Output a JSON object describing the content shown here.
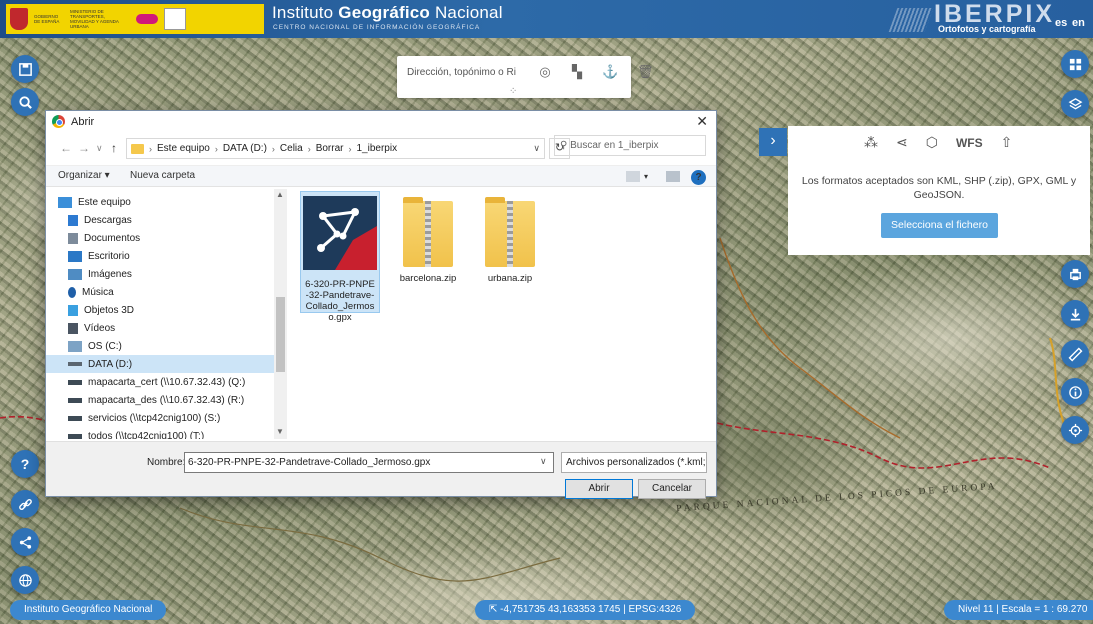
{
  "header": {
    "gov_text_1": "GOBIERNO DE ESPAÑA",
    "gov_text_2": "MINISTERIO DE TRANSPORTES, MOVILIDAD Y AGENDA URBANA",
    "ign_title_light": "Instituto ",
    "ign_title_bold": "Geográfico",
    "ign_title_rest": " Nacional",
    "ign_subtitle": "CENTRO NACIONAL DE INFORMACIÓN GEOGRÁFICA",
    "app_title": "IBERPIX",
    "app_subtitle": "Ortofotos y cartografía",
    "lang_es": "es",
    "lang_en": "en"
  },
  "search": {
    "placeholder": "Dirección, topónimo o Ri"
  },
  "map": {
    "park_label": "PARQUE NACIONAL DE LOS PICOS DE EUROPA"
  },
  "import_panel": {
    "wfs_label": "WFS",
    "message": "Los formatos aceptados son KML, SHP (.zip), GPX, GML y GeoJSON.",
    "select_button": "Selecciona el fichero"
  },
  "dialog": {
    "title": "Abrir",
    "close": "✕",
    "breadcrumb": [
      "Este equipo",
      "DATA (D:)",
      "Celia",
      "Borrar",
      "1_iberpix"
    ],
    "search_placeholder": "Buscar en 1_iberpix",
    "organize": "Organizar ▾",
    "new_folder": "Nueva carpeta",
    "tree": [
      {
        "label": "Este equipo",
        "color": "#3b8fd9"
      },
      {
        "label": "Descargas",
        "color": "#2d7ad1"
      },
      {
        "label": "Documentos",
        "color": "#7d8b9b"
      },
      {
        "label": "Escritorio",
        "color": "#2b78c6"
      },
      {
        "label": "Imágenes",
        "color": "#4f8cc3"
      },
      {
        "label": "Música",
        "color": "#1f5fa8"
      },
      {
        "label": "Objetos 3D",
        "color": "#3aa0e0"
      },
      {
        "label": "Vídeos",
        "color": "#4a5562"
      },
      {
        "label": "OS (C:)",
        "color": "#7da3c5"
      },
      {
        "label": "DATA (D:)",
        "color": "#5b6670"
      },
      {
        "label": "mapacarta_cert (\\\\10.67.32.43) (Q:)",
        "color": "#3d4a55"
      },
      {
        "label": "mapacarta_des (\\\\10.67.32.43) (R:)",
        "color": "#3d4a55"
      },
      {
        "label": "servicios (\\\\tcp42cnig100) (S:)",
        "color": "#3d4a55"
      },
      {
        "label": "todos (\\\\tcp42cnig100) (T:)",
        "color": "#3d4a55"
      }
    ],
    "files": [
      {
        "name": "6-320-PR-PNPE-32-Pandetrave-Collado_Jermoso.gpx",
        "display": "6-320-PR-PNPE-32-Pandetrave-Collado_Jermoso.gpx"
      },
      {
        "name": "barcelona.zip",
        "display": "barcelona.zip"
      },
      {
        "name": "urbana.zip",
        "display": "urbana.zip"
      }
    ],
    "filename_label": "Nombre:",
    "filename_value": "6-320-PR-PNPE-32-Pandetrave-Collado_Jermoso.gpx",
    "filetype": "Archivos personalizados (*.kml; ∨",
    "open_button": "Abrir",
    "cancel_button": "Cancelar"
  },
  "footer": {
    "ign_label": "Instituto Geográfico Nacional",
    "coords": "-4,751735  43,163353  1745 | EPSG:4326",
    "scale": "Nivel 11 | Escala = 1 : 69.270"
  },
  "colors": {
    "brand_blue": "#2f72b6",
    "header_blue": "#1d4d88",
    "selected_bg": "#cce4f7",
    "zip_yellow": "#f1c24b",
    "gpx_red": "#c8202e"
  }
}
